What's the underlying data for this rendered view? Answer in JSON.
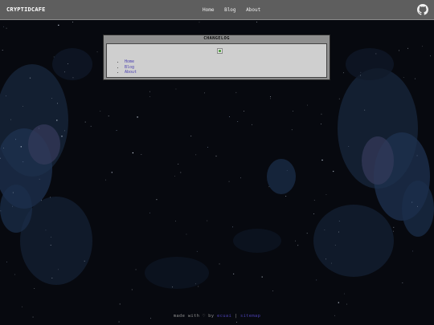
{
  "header": {
    "brand": "CRYPTIDCAFE",
    "nav": [
      {
        "label": "Home"
      },
      {
        "label": "Blog"
      },
      {
        "label": "About"
      }
    ],
    "github_icon": "github-icon"
  },
  "changelog": {
    "title": "CHANGELOG",
    "image_icon": "broken-image-icon",
    "links": [
      {
        "label": "Home"
      },
      {
        "label": "Blog"
      },
      {
        "label": "About"
      }
    ]
  },
  "footer": {
    "made_with": "made with",
    "heart": "♡",
    "by": "by",
    "author": "ecuai",
    "separator": "|",
    "sitemap": "sitemap"
  },
  "colors": {
    "background": "#07090f",
    "topbar": "#5e5e5e",
    "panel": "#8f8f8f",
    "panel_inner": "#cfcfcf",
    "link": "#4a3fb0"
  }
}
